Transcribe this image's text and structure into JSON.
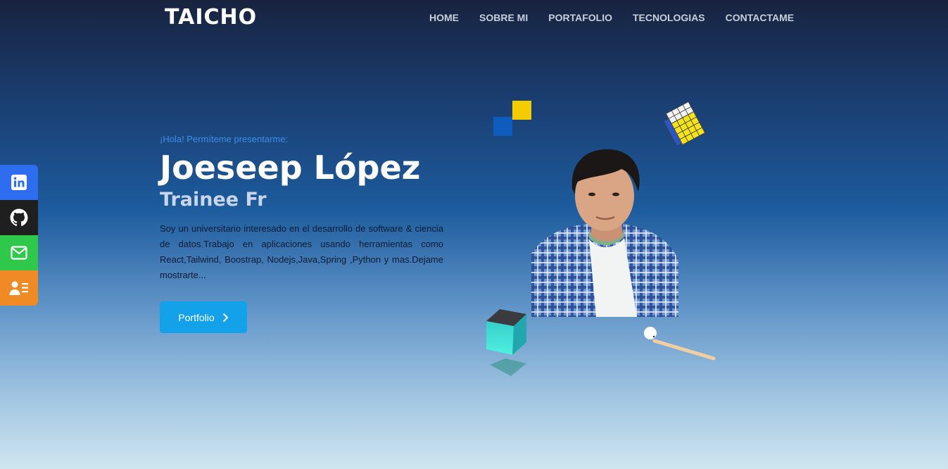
{
  "brand": {
    "logo": "TAICHO"
  },
  "nav": {
    "items": [
      "HOME",
      "SOBRE MI",
      "PORTAFOLIO",
      "TECNOLOGIAS",
      "CONTACTAME"
    ]
  },
  "social": [
    {
      "icon": "linkedin-icon",
      "color": "#2f6df0"
    },
    {
      "icon": "github-icon",
      "color": "#1f1f1f"
    },
    {
      "icon": "mail-icon",
      "color": "#2fc84a"
    },
    {
      "icon": "contact-card-icon",
      "color": "#f08a24"
    }
  ],
  "hero": {
    "greeting": "¡Hola! Permíteme presentarme:",
    "name": "Joeseep López",
    "role": "Trainee Fr",
    "description": "Soy un universitario interesado en el desarrollo de software & ciencia de datos.Trabajo en aplicaciones usando herramientas como React,Tailwind, Boostrap, Nodejs,Java,Spring ,Python y mas.Dejame mostrarte...",
    "button_label": "Portfolio"
  },
  "colors": {
    "accent": "#13a2ea",
    "greeting": "#3d8de8"
  }
}
